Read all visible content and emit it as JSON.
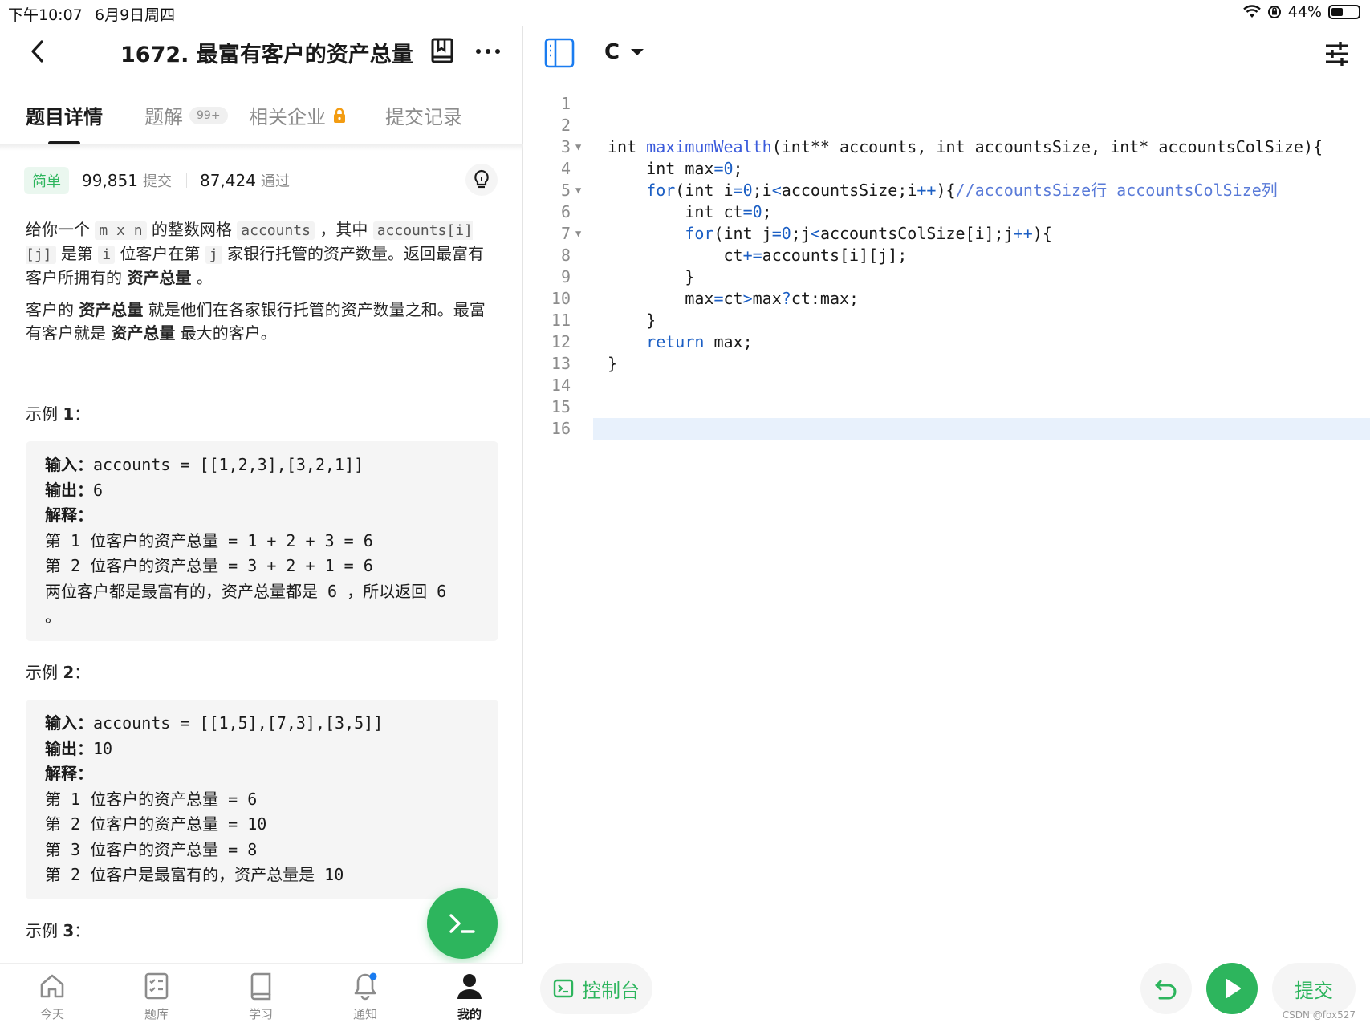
{
  "status": {
    "time": "下午10:07",
    "date": "6月9日周四",
    "battery": "44%",
    "battery_level": 0.44
  },
  "header": {
    "title": "1672. 最富有客户的资产总量"
  },
  "tabs": [
    {
      "label": "题目详情",
      "active": true
    },
    {
      "label": "题解",
      "badge": "99+"
    },
    {
      "label": "相关企业"
    },
    {
      "label": "提交记录"
    }
  ],
  "stats": {
    "difficulty": "简单",
    "submissions": "99,851",
    "submissions_label": "提交",
    "accepted": "87,424",
    "accepted_label": "通过"
  },
  "description": {
    "p1_a": "给你一个",
    "p1_code1": "m x n",
    "p1_b": "的整数网格",
    "p1_code2": "accounts",
    "p1_c": "，其中",
    "p1_code3": "accounts[i][j]",
    "p1_d": "是第",
    "p1_code4": "i",
    "p1_e": "位客户在第",
    "p1_code5": "j",
    "p1_f": "家银行托管的资产数量。返回最富有客户所拥有的",
    "p1_bold": "资产总量",
    "p1_g": "。",
    "p2_a": "客户的",
    "p2_bold1": "资产总量",
    "p2_b": "就是他们在各家银行托管的资产数量之和。最富有客户就是",
    "p2_bold2": "资产总量",
    "p2_c": "最大的客户。"
  },
  "examples": [
    {
      "title_prefix": "示例 ",
      "title_num": "1",
      "title_suffix": "：",
      "lines": [
        {
          "key": "输入：",
          "text": "accounts = [[1,2,3],[3,2,1]]"
        },
        {
          "key": "输出：",
          "text": "6"
        },
        {
          "key": "解释：",
          "text": ""
        },
        {
          "key": "",
          "text": "第 1 位客户的资产总量 = 1 + 2 + 3 = 6"
        },
        {
          "key": "",
          "text": "第 2 位客户的资产总量 = 3 + 2 + 1 = 6"
        },
        {
          "key": "",
          "text": "两位客户都是最富有的，资产总量都是 6 ，所以返回 6"
        },
        {
          "key": "",
          "text": "。"
        }
      ]
    },
    {
      "title_prefix": "示例 ",
      "title_num": "2",
      "title_suffix": "：",
      "lines": [
        {
          "key": "输入：",
          "text": "accounts = [[1,5],[7,3],[3,5]]"
        },
        {
          "key": "输出：",
          "text": "10"
        },
        {
          "key": "解释：",
          "text": ""
        },
        {
          "key": "",
          "text": "第 1 位客户的资产总量 = 6"
        },
        {
          "key": "",
          "text": "第 2 位客户的资产总量 = 10"
        },
        {
          "key": "",
          "text": "第 3 位客户的资产总量 = 8"
        },
        {
          "key": "",
          "text": "第 2 位客户是最富有的，资产总量是 10"
        }
      ]
    },
    {
      "title_prefix": "示例 ",
      "title_num": "3",
      "title_suffix": "："
    }
  ],
  "bottom_nav": [
    {
      "label": "今天",
      "icon": "home-icon"
    },
    {
      "label": "题库",
      "icon": "problem-list-icon"
    },
    {
      "label": "学习",
      "icon": "book-icon"
    },
    {
      "label": "通知",
      "icon": "bell-icon"
    },
    {
      "label": "我的",
      "icon": "profile-icon",
      "active": true
    }
  ],
  "editor": {
    "language": "C",
    "lines": [
      {
        "n": "1",
        "fold": false,
        "code": ""
      },
      {
        "n": "2",
        "fold": false,
        "code": ""
      },
      {
        "n": "3",
        "fold": true,
        "code": "int maximumWealth(int** accounts, int accountsSize, int* accountsColSize){"
      },
      {
        "n": "4",
        "fold": false,
        "code": "    int max=0;"
      },
      {
        "n": "5",
        "fold": true,
        "code": "    for(int i=0;i<accountsSize;i++){//accountsSize行 accountsColSize列"
      },
      {
        "n": "6",
        "fold": false,
        "code": "        int ct=0;"
      },
      {
        "n": "7",
        "fold": true,
        "code": "        for(int j=0;j<accountsColSize[i];j++){"
      },
      {
        "n": "8",
        "fold": false,
        "code": "            ct+=accounts[i][j];"
      },
      {
        "n": "9",
        "fold": false,
        "code": "        }"
      },
      {
        "n": "10",
        "fold": false,
        "code": "        max=ct>max?ct:max;"
      },
      {
        "n": "11",
        "fold": false,
        "code": "    }"
      },
      {
        "n": "12",
        "fold": false,
        "code": "    return max;"
      },
      {
        "n": "13",
        "fold": false,
        "code": "}"
      },
      {
        "n": "14",
        "fold": false,
        "code": ""
      },
      {
        "n": "15",
        "fold": false,
        "code": ""
      },
      {
        "n": "16",
        "fold": false,
        "code": "",
        "current": true
      }
    ],
    "console_label": "控制台",
    "submit_label": "提交"
  },
  "watermark": "CSDN @fox527",
  "colors": {
    "accent": "#2db55d",
    "keyword": "#1c5fc4",
    "current_line": "#e8f1fc"
  }
}
